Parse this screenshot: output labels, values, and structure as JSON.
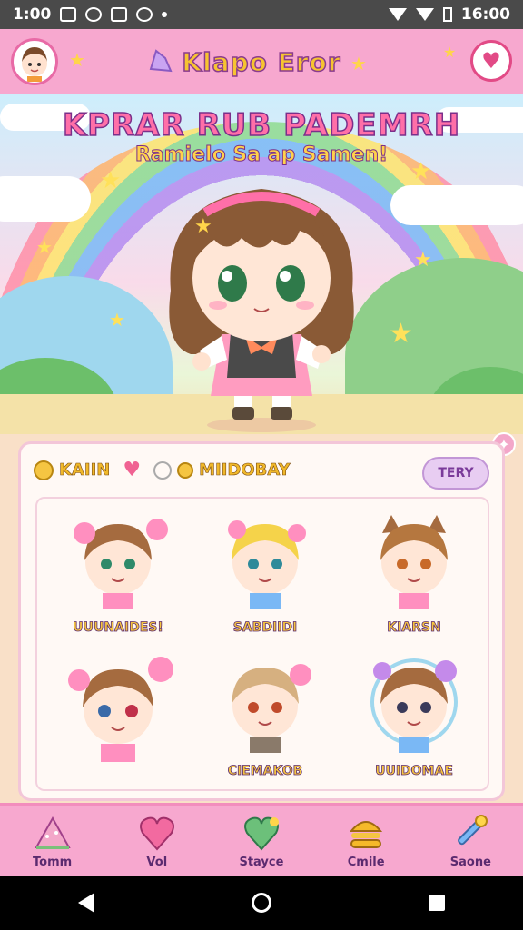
{
  "status_bar": {
    "time": "1:00",
    "clock_right": "16:00"
  },
  "header": {
    "title": "Klapo Eror"
  },
  "hero": {
    "headline": "KPRAR RUB PADEMRH",
    "subline": "Ramielo Sa ap Samen!"
  },
  "panel": {
    "tab_coins_label": "KAIIN",
    "tab_history_label": "MIIDOBAY",
    "verify_label": "TERY",
    "stickers": [
      {
        "label": "UUUNAIDES!"
      },
      {
        "label": "SABDIIDI"
      },
      {
        "label": "KIARSN"
      },
      {
        "label": ""
      },
      {
        "label": "CIEMAKOB"
      },
      {
        "label": "UUIDOMAE"
      }
    ]
  },
  "bottom_nav": {
    "items": [
      {
        "label": "Tomm",
        "icon": "tent-icon"
      },
      {
        "label": "Vol",
        "icon": "heart-icon"
      },
      {
        "label": "Stayce",
        "icon": "green-heart-icon"
      },
      {
        "label": "Cmile",
        "icon": "burger-icon"
      },
      {
        "label": "Saone",
        "icon": "wand-icon"
      }
    ]
  },
  "colors": {
    "header_pink": "#f7a8cf",
    "title_yellow": "#f7c430",
    "accent_purple": "#8a3b8f"
  }
}
